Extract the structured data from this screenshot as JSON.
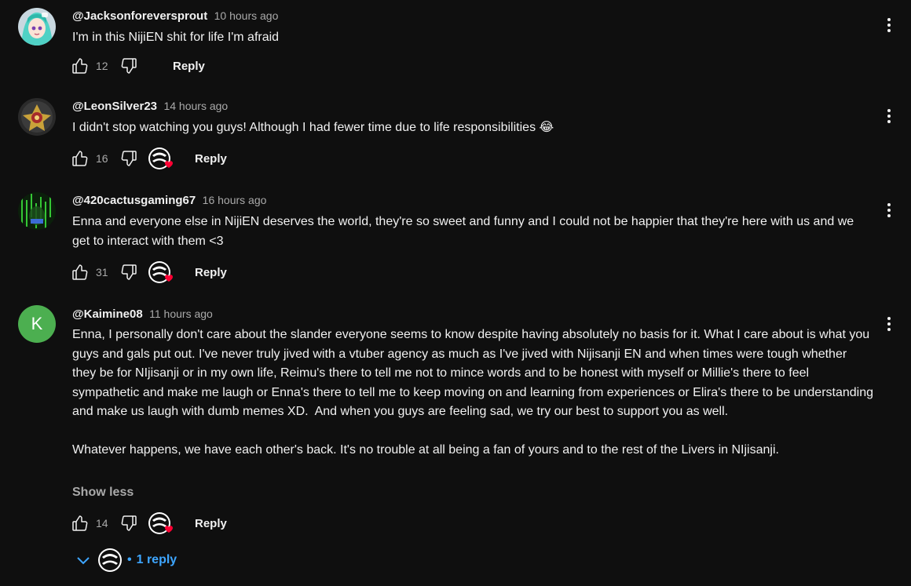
{
  "colors": {
    "background": "#0f0f0f",
    "text_primary": "#f1f1f1",
    "text_secondary": "#aaaaaa",
    "link_blue": "#3ea6ff",
    "heart_red": "#ff0033",
    "avatar_k_bg": "#4caf50"
  },
  "comments": [
    {
      "author": "@Jacksonforeversprout",
      "time": "10 hours ago",
      "text": "I'm in this NijiEN shit for life I'm afraid",
      "likes": "12",
      "reply_label": "Reply",
      "creator_heart": false,
      "avatar": "anime-character-avatar"
    },
    {
      "author": "@LeonSilver23",
      "time": "14 hours ago",
      "text": "I didn't stop watching you guys! Although I had fewer time due to life responsibilities 😂",
      "likes": "16",
      "reply_label": "Reply",
      "creator_heart": true,
      "avatar": "emblem-avatar"
    },
    {
      "author": "@420cactusgaming67",
      "time": "16 hours ago",
      "text": "Enna and everyone else in NijiEN deserves the world, they're so sweet and funny and I could not be happier that they're here with us and we get to interact with them <3",
      "likes": "31",
      "reply_label": "Reply",
      "creator_heart": true,
      "avatar": "green-matrix-avatar"
    },
    {
      "author": "@Kaimine08",
      "time": "11 hours ago",
      "text": "Enna, I personally don't care about the slander everyone seems to know despite having absolutely no basis for it. What I care about is what you guys and gals put out. I've never truly jived with a vtuber agency as much as I've jived with Nijisanji EN and when times were tough whether they be for NIjisanji or in my own life, Reimu's there to tell me not to mince words and to be honest with myself or Millie's there to feel sympathetic and make me laugh or Enna's there to tell me to keep moving on and learning from experiences or Elira's there to be understanding and make us laugh with dumb memes XD.  And when you guys are feeling sad, we try our best to support you as well.\n\nWhatever happens, we have each other's back. It's no trouble at all being a fan of yours and to the rest of the Livers in NIjisanji.",
      "show_less": "Show less",
      "likes": "14",
      "reply_label": "Reply",
      "creator_heart": true,
      "avatar_letter": "K"
    }
  ],
  "replies_toggle": {
    "dot": "•",
    "label": "1 reply"
  }
}
